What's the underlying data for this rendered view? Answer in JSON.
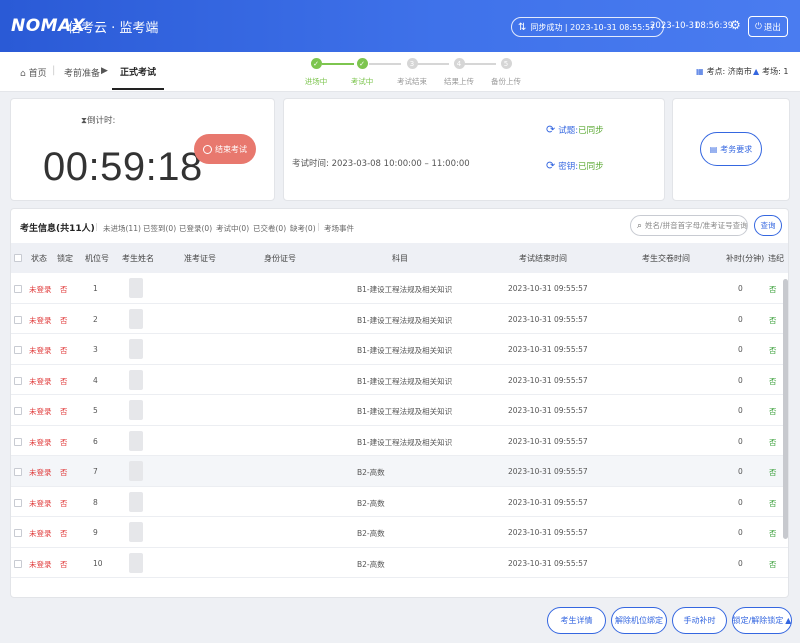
{
  "header": {
    "logo": "NOMAX",
    "title": "信考云 · 监考端",
    "sync_status": "同步成功 | 2023-10-31 08:55:57",
    "date": "2023-10-31",
    "time": "08:56:39",
    "logout": "退出"
  },
  "nav": {
    "home": "首页",
    "pre_exam": "考前准备",
    "current": "正式考试",
    "steps": [
      {
        "label": "进场中",
        "done": true,
        "number": ""
      },
      {
        "label": "考试中",
        "done": true,
        "number": ""
      },
      {
        "label": "考试结束",
        "done": false,
        "number": "3"
      },
      {
        "label": "结果上传",
        "done": false,
        "number": "4"
      },
      {
        "label": "备份上传",
        "done": false,
        "number": "5"
      }
    ],
    "site_label": "考点: 济南市",
    "room_label": "考场: 1"
  },
  "countdown": {
    "label": "倒计时:",
    "value": "00:59:18",
    "end_button": "结束考试"
  },
  "exam_info": {
    "time": "考试时间: 2023-03-08 10:00:00 – 11:00:00",
    "questions_label": "试题:",
    "questions_status": "已同步",
    "key_label": "密钥:",
    "key_status": "已同步"
  },
  "requirements_button": "考务要求",
  "filters": {
    "title": "考生信息(共11人)",
    "tabs": [
      "未进场(11)",
      "已签到(0)",
      "已登录(0)",
      "考试中(0)",
      "已交卷(0)",
      "缺考(0)",
      "考场事件"
    ],
    "search_placeholder": "姓名/拼音首字母/准考证号查询",
    "search_button": "查询"
  },
  "table": {
    "columns": [
      "状态",
      "锁定",
      "机位号",
      "考生姓名",
      "准考证号",
      "身份证号",
      "科目",
      "考试结束时间",
      "考生交卷时间",
      "补时(分钟)",
      "违纪"
    ],
    "rows": [
      {
        "status": "未登录",
        "locked": "否",
        "seat": "1",
        "subject": "B1-建设工程法规及相关知识",
        "end_time": "2023-10-31 09:55:57",
        "extra": "0",
        "violation": "否"
      },
      {
        "status": "未登录",
        "locked": "否",
        "seat": "2",
        "subject": "B1-建设工程法规及相关知识",
        "end_time": "2023-10-31 09:55:57",
        "extra": "0",
        "violation": "否"
      },
      {
        "status": "未登录",
        "locked": "否",
        "seat": "3",
        "subject": "B1-建设工程法规及相关知识",
        "end_time": "2023-10-31 09:55:57",
        "extra": "0",
        "violation": "否"
      },
      {
        "status": "未登录",
        "locked": "否",
        "seat": "4",
        "subject": "B1-建设工程法规及相关知识",
        "end_time": "2023-10-31 09:55:57",
        "extra": "0",
        "violation": "否"
      },
      {
        "status": "未登录",
        "locked": "否",
        "seat": "5",
        "subject": "B1-建设工程法规及相关知识",
        "end_time": "2023-10-31 09:55:57",
        "extra": "0",
        "violation": "否"
      },
      {
        "status": "未登录",
        "locked": "否",
        "seat": "6",
        "subject": "B1-建设工程法规及相关知识",
        "end_time": "2023-10-31 09:55:57",
        "extra": "0",
        "violation": "否"
      },
      {
        "status": "未登录",
        "locked": "否",
        "seat": "7",
        "subject": "B2-高数",
        "end_time": "2023-10-31 09:55:57",
        "extra": "0",
        "violation": "否"
      },
      {
        "status": "未登录",
        "locked": "否",
        "seat": "8",
        "subject": "B2-高数",
        "end_time": "2023-10-31 09:55:57",
        "extra": "0",
        "violation": "否"
      },
      {
        "status": "未登录",
        "locked": "否",
        "seat": "9",
        "subject": "B2-高数",
        "end_time": "2023-10-31 09:55:57",
        "extra": "0",
        "violation": "否"
      },
      {
        "status": "未登录",
        "locked": "否",
        "seat": "10",
        "subject": "B2-高数",
        "end_time": "2023-10-31 09:55:57",
        "extra": "0",
        "violation": "否"
      }
    ]
  },
  "footer": {
    "details": "考生详情",
    "unbind_seat": "解除机位绑定",
    "manual_extra": "手动补时",
    "lock_unlock": "锁定/解除锁定"
  },
  "colors": {
    "primary": "#3567e0",
    "success": "#7dc54f",
    "danger": "#e03b3b",
    "end_button": "#e8786e"
  }
}
